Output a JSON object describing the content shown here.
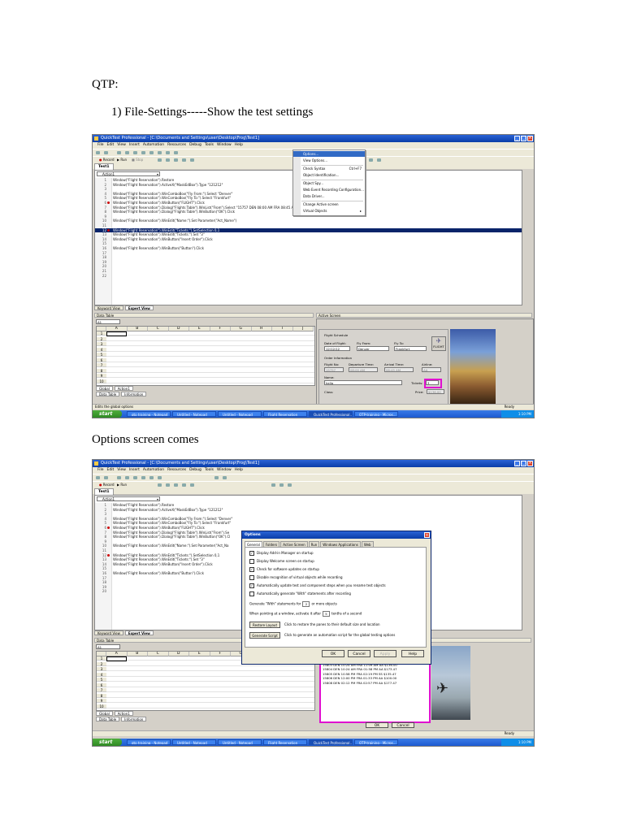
{
  "doc": {
    "heading": "QTP:",
    "step1": "1)  File-Settings-----Show the test settings",
    "caption2": "Options screen comes"
  },
  "colors": {
    "titlebar": "#0a3ea8",
    "taskbar": "#1d5ad0",
    "start": "#2f8a24",
    "highlight": "#0a246a",
    "magenta": "#e010d0"
  },
  "app": {
    "title": "QuickTest Professional - [C:\\Documents and Settings\\user\\Desktop\\Frog\\Test1]",
    "title_short": "QuickTest Professional - [C:\\Documents and Settings\\user\\Desktop\\Frog\\Test1]",
    "menu": [
      "File",
      "Edit",
      "View",
      "Insert",
      "Automation",
      "Resources",
      "Debug",
      "Tools",
      "Window",
      "Help"
    ],
    "new_label": "New",
    "open_label": "Open",
    "record_label": "Record",
    "run_label": "Run",
    "stop_label": "Stop",
    "doc_tab": "Test1",
    "action_combo": "Action1",
    "view_tabs": [
      "Keyword View",
      "Expert View"
    ],
    "status_left1": "Edits the global options",
    "status_right": "Ready",
    "datatable_title": "Data Table",
    "cell_ref": "A1",
    "columns": [
      "A",
      "B",
      "C",
      "D",
      "E",
      "F",
      "G",
      "H",
      "I",
      "J"
    ],
    "rows": [
      "1",
      "2",
      "3",
      "4",
      "5",
      "6",
      "7",
      "8",
      "9",
      "10"
    ],
    "sheet_tabs": [
      "Global",
      "Action1"
    ],
    "bottom_tabs": [
      "Data Table",
      "Information"
    ],
    "activescreen_title": "Active Screen"
  },
  "code1": [
    {
      "n": "1",
      "t": "Window(\"Flight Reservation\").Restore",
      "bp": false,
      "hl": false
    },
    {
      "n": "2",
      "t": "Window(\"Flight Reservation\").ActiveX(\"MaskEdBox\").Type \"121212\"",
      "bp": false,
      "hl": false
    },
    {
      "n": "3",
      "t": "",
      "bp": false,
      "hl": false
    },
    {
      "n": "4",
      "t": "Window(\"Flight Reservation\").WinComboBox(\"Fly From:\").Select \"Denver\"",
      "bp": false,
      "hl": false
    },
    {
      "n": "5",
      "t": "Window(\"Flight Reservation\").WinComboBox(\"Fly To:\").Select \"Frankfurt\"",
      "bp": false,
      "hl": false
    },
    {
      "n": "6",
      "t": "Window(\"Flight Reservation\").WinButton(\"FLIGHT\").Click",
      "bp": true,
      "hl": false
    },
    {
      "n": "7",
      "t": "Window(\"Flight Reservation\").Dialog(\"Flights Table\").WinList(\"From\").Select \"15757   DEN   08:00 AM   FRA   08:45 AM   AA   $136.00\"",
      "bp": false,
      "hl": false
    },
    {
      "n": "8",
      "t": "Window(\"Flight Reservation\").Dialog(\"Flights Table\").WinButton(\"OK\").Click",
      "bp": false,
      "hl": false
    },
    {
      "n": "9",
      "t": "",
      "bp": false,
      "hl": false
    },
    {
      "n": "10",
      "t": "Window(\"Flight Reservation\").WinEdit(\"Name:\").Set Parameter(\"Act_Name\")",
      "bp": false,
      "hl": false
    },
    {
      "n": "11",
      "t": "",
      "bp": false,
      "hl": false
    },
    {
      "n": "12",
      "t": "Window(\"Flight Reservation\").WinEdit(\"Tickets:\").SetSelection 0,1",
      "bp": true,
      "hl": true
    },
    {
      "n": "13",
      "t": "Window(\"Flight Reservation\").WinEdit(\"Tickets:\").Set \"3\"",
      "bp": false,
      "hl": false
    },
    {
      "n": "14",
      "t": "Window(\"Flight Reservation\").WinButton(\"Insert Order\").Click",
      "bp": false,
      "hl": false
    },
    {
      "n": "15",
      "t": "",
      "bp": false,
      "hl": false
    },
    {
      "n": "16",
      "t": "Window(\"Flight Reservation\").WinButton(\"Button\").Click",
      "bp": false,
      "hl": false
    },
    {
      "n": "17",
      "t": "",
      "bp": false,
      "hl": false
    },
    {
      "n": "18",
      "t": "",
      "bp": false,
      "hl": false
    },
    {
      "n": "19",
      "t": "",
      "bp": false,
      "hl": false
    },
    {
      "n": "20",
      "t": "",
      "bp": false,
      "hl": false
    },
    {
      "n": "21",
      "t": "",
      "bp": false,
      "hl": false
    },
    {
      "n": "22",
      "t": "",
      "bp": false,
      "hl": false
    }
  ],
  "tools_menu": [
    {
      "label": "Options...",
      "shortcut": "",
      "sel": true
    },
    {
      "label": "View Options...",
      "shortcut": "",
      "sel": false
    },
    {
      "label": "Check Syntax",
      "shortcut": "Ctrl+F7",
      "sel": false
    },
    {
      "label": "Object Identification...",
      "shortcut": "",
      "sel": false
    },
    {
      "label": "Object Spy...",
      "shortcut": "",
      "sel": false
    },
    {
      "label": "Web Event Recording Configuration...",
      "shortcut": "",
      "sel": false
    },
    {
      "label": "Data Driver...",
      "shortcut": "",
      "sel": false
    },
    {
      "label": "Change Active screen",
      "shortcut": "",
      "sel": false
    },
    {
      "label": "Virtual Objects",
      "shortcut": "▸",
      "sel": false
    }
  ],
  "flight_form": {
    "group_title": "Flight Schedule",
    "date_label": "Date of Flight:",
    "date_value": "12/12/12",
    "from_label": "Fly From:",
    "from_value": "Denver",
    "to_label": "Fly To:",
    "to_value": "Frankfurt",
    "flights_btn": "FLIGHT",
    "order_title": "Order Information",
    "flightno_label": "Flight No:",
    "flightno_value": "15757",
    "dep_label": "Departure Time:",
    "dep_value": "08:00 AM",
    "arr_label": "Arrival Time:",
    "arr_value": "08:45 AM",
    "airline_label": "Airline:",
    "airline_value": "AA",
    "name_label": "Name:",
    "name_value": "hello",
    "tickets_label": "Tickets:",
    "tickets_value": "3",
    "class_label": "Class:",
    "price_label": "Price:",
    "price_value": "$136.00"
  },
  "taskbar": {
    "start": "start",
    "tasks": [
      "qtp training - Notepad",
      "Untitled - Notepad",
      "Untitled - Notepad",
      "Flight Reservation",
      "QuickTest Professional...",
      "QTP-training - Micros..."
    ],
    "clock": "1:10 PM"
  },
  "options": {
    "title": "Options",
    "tabs": [
      "General",
      "Folders",
      "Active Screen",
      "Run",
      "Windows Applications",
      "Web"
    ],
    "checks": [
      {
        "label": "Display Add-in Manager on startup",
        "checked": true
      },
      {
        "label": "Display Welcome screen on startup",
        "checked": false
      },
      {
        "label": "Check for software updates on startup",
        "checked": true
      },
      {
        "label": "Disable recognition of virtual objects while recording",
        "checked": false
      },
      {
        "label": "Automatically update test and component steps when you rename test objects",
        "checked": true
      },
      {
        "label": "Automatically generate \"With\" statements after recording",
        "checked": false
      }
    ],
    "with_prefix": "Generate \"With\" statements for",
    "with_value": "2",
    "with_suffix": "or more objects",
    "point_prefix": "When pointing at a window, activate it after",
    "point_value": "5",
    "point_suffix": "tenths of a second",
    "restore_btn": "Restore Layout",
    "restore_desc": "Click to restore the panes to their default size and location",
    "gen_btn": "Generate Script",
    "gen_desc": "Click to generate an automation script for the global testing options",
    "ok": "OK",
    "cancel": "Cancel",
    "apply": "Apply",
    "help": "Help"
  },
  "code2": [
    {
      "n": "1",
      "t": "Window(\"Flight Reservation\").Restore",
      "bp": false
    },
    {
      "n": "2",
      "t": "Window(\"Flight Reservation\").ActiveX(\"MaskEdBox\").Type \"121212\"",
      "bp": false
    },
    {
      "n": "3",
      "t": "",
      "bp": false
    },
    {
      "n": "4",
      "t": "Window(\"Flight Reservation\").WinComboBox(\"Fly From:\").Select \"Denver\"",
      "bp": false
    },
    {
      "n": "5",
      "t": "Window(\"Flight Reservation\").WinComboBox(\"Fly To:\").Select \"Frankfurt\"",
      "bp": false
    },
    {
      "n": "6",
      "t": "Window(\"Flight Reservation\").WinButton(\"FLIGHT\").Click",
      "bp": true
    },
    {
      "n": "7",
      "t": "Window(\"Flight Reservation\").Dialog(\"Flights Table\").WinList(\"From\").Se",
      "bp": false
    },
    {
      "n": "8",
      "t": "Window(\"Flight Reservation\").Dialog(\"Flights Table\").WinButton(\"OK\").Cl",
      "bp": false
    },
    {
      "n": "9",
      "t": "",
      "bp": false
    },
    {
      "n": "10",
      "t": "Window(\"Flight Reservation\").WinEdit(\"Name:\").Set Parameter(\"Act_Na",
      "bp": false
    },
    {
      "n": "11",
      "t": "",
      "bp": false
    },
    {
      "n": "12",
      "t": "Window(\"Flight Reservation\").WinEdit(\"Tickets:\").SetSelection 0,1",
      "bp": true
    },
    {
      "n": "13",
      "t": "Window(\"Flight Reservation\").WinEdit(\"Tickets:\").Set \"3\"",
      "bp": false
    },
    {
      "n": "14",
      "t": "Window(\"Flight Reservation\").WinButton(\"Insert Order\").Click",
      "bp": false
    },
    {
      "n": "15",
      "t": "",
      "bp": false
    },
    {
      "n": "16",
      "t": "Window(\"Flight Reservation\").WinButton(\"Button\").Click",
      "bp": false
    },
    {
      "n": "17",
      "t": "",
      "bp": false
    },
    {
      "n": "18",
      "t": "",
      "bp": false
    },
    {
      "n": "19",
      "t": "",
      "bp": false
    },
    {
      "n": "20",
      "t": "",
      "bp": false
    }
  ],
  "flights_list": {
    "col_airline": "Airline",
    "col_price": "Price",
    "rows": [
      {
        "t": "                                     AA   $136.00",
        "sel": false
      },
      {
        "t": "                                     AA   $126.40",
        "sel": false
      },
      {
        "t": "                                     AA   $135.00",
        "sel": true
      },
      {
        "t": "15803   DEN   10:24 AM   FRA   11:09 AM   AA   $136.00",
        "sel": false
      },
      {
        "t": "15804   DEN   10:24 AM   FRA   01:58 PM   AA   $173.47",
        "sel": false
      },
      {
        "t": "15805   DEN   10:58 PM   FRA   02:19 PM   SS   $135.47",
        "sel": false
      },
      {
        "t": "15806   DEN   12:00 PM   FRA   01:33 PM   AA   $100.00",
        "sel": false
      },
      {
        "t": "15808   DEN   02:12 PM   FRA   02:57 PM   AA   $177.47",
        "sel": false
      }
    ],
    "ok": "OK",
    "cancel": "Cancel"
  }
}
